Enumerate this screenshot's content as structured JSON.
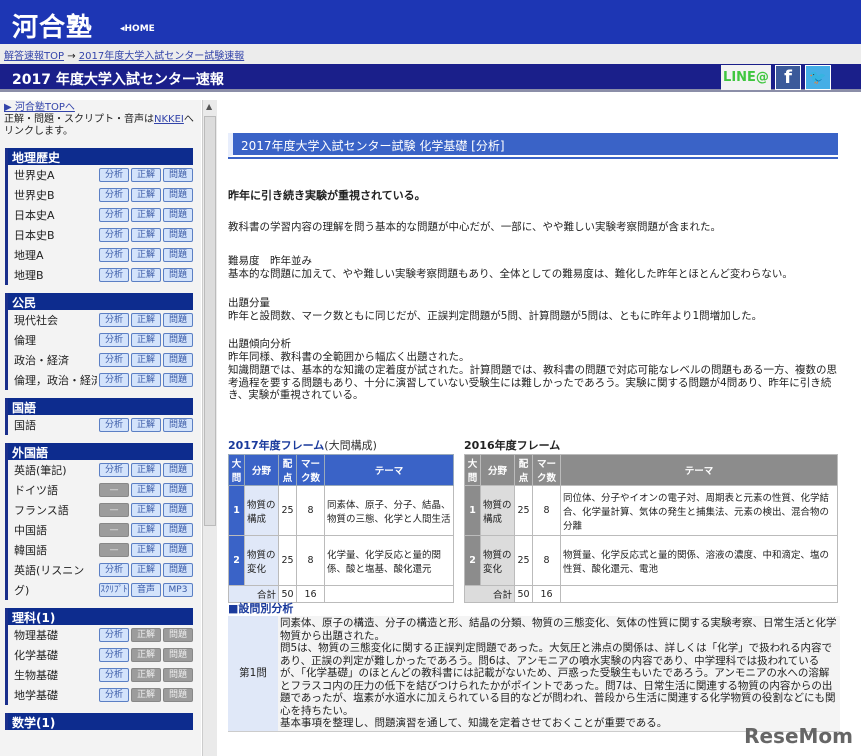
{
  "header": {
    "logo": "河合塾",
    "home": "◂HOME"
  },
  "breadcrumb": {
    "top": "解答速報TOP",
    "arrow": " → ",
    "current": "2017年度大学入試センター試験速報"
  },
  "title_bar": {
    "title": "2017 年度大学入試センター速報",
    "line": "LINE@",
    "facebook": "f",
    "twitter": "t"
  },
  "sidebar": {
    "top_link": "▶ 河合塾TOPへ",
    "note_pre": "正解・問題・スクリプト・音声は",
    "note_link": "NKKEI",
    "note_post": "へリンクします。",
    "sections": [
      {
        "title": "地理歴史",
        "rows": [
          {
            "label": "世界史A",
            "b": [
              "分析",
              "正解",
              "問題"
            ],
            "off": []
          },
          {
            "label": "世界史B",
            "b": [
              "分析",
              "正解",
              "問題"
            ],
            "off": []
          },
          {
            "label": "日本史A",
            "b": [
              "分析",
              "正解",
              "問題"
            ],
            "off": []
          },
          {
            "label": "日本史B",
            "b": [
              "分析",
              "正解",
              "問題"
            ],
            "off": []
          },
          {
            "label": "地理A",
            "b": [
              "分析",
              "正解",
              "問題"
            ],
            "off": []
          },
          {
            "label": "地理B",
            "b": [
              "分析",
              "正解",
              "問題"
            ],
            "off": []
          }
        ]
      },
      {
        "title": "公民",
        "rows": [
          {
            "label": "現代社会",
            "b": [
              "分析",
              "正解",
              "問題"
            ],
            "off": []
          },
          {
            "label": "倫理",
            "b": [
              "分析",
              "正解",
              "問題"
            ],
            "off": []
          },
          {
            "label": "政治・経済",
            "b": [
              "分析",
              "正解",
              "問題"
            ],
            "off": []
          },
          {
            "label": "倫理，政治・経済",
            "b": [
              "分析",
              "正解",
              "問題"
            ],
            "off": []
          }
        ]
      },
      {
        "title": "国語",
        "rows": [
          {
            "label": "国語",
            "b": [
              "分析",
              "正解",
              "問題"
            ],
            "off": []
          }
        ]
      },
      {
        "title": "外国語",
        "rows": [
          {
            "label": "英語(筆記)",
            "b": [
              "分析",
              "正解",
              "問題"
            ],
            "off": []
          },
          {
            "label": "ドイツ語",
            "b": [
              "—",
              "正解",
              "問題"
            ],
            "off": [
              0
            ]
          },
          {
            "label": "フランス語",
            "b": [
              "—",
              "正解",
              "問題"
            ],
            "off": [
              0
            ]
          },
          {
            "label": "中国語",
            "b": [
              "—",
              "正解",
              "問題"
            ],
            "off": [
              0
            ]
          },
          {
            "label": "韓国語",
            "b": [
              "—",
              "正解",
              "問題"
            ],
            "off": [
              0
            ]
          },
          {
            "label": "英語(リスニン",
            "b": [
              "分析",
              "正解",
              "問題"
            ],
            "off": []
          },
          {
            "label": "グ)",
            "b": [
              "ｽｸﾘﾌﾟﾄ",
              "音声",
              "MP3"
            ],
            "off": []
          }
        ]
      },
      {
        "title": "理科(1)",
        "rows": [
          {
            "label": "物理基礎",
            "b": [
              "分析",
              "正解",
              "問題"
            ],
            "off": [
              1,
              2
            ]
          },
          {
            "label": "化学基礎",
            "b": [
              "分析",
              "正解",
              "問題"
            ],
            "off": [
              1,
              2
            ]
          },
          {
            "label": "生物基礎",
            "b": [
              "分析",
              "正解",
              "問題"
            ],
            "off": [
              1,
              2
            ]
          },
          {
            "label": "地学基礎",
            "b": [
              "分析",
              "正解",
              "問題"
            ],
            "off": [
              1,
              2
            ]
          }
        ]
      },
      {
        "title": "数学(1)",
        "rows": []
      }
    ]
  },
  "main": {
    "page_title": "2017年度大学入試センター試験 化学基礎 [分析]",
    "lead": "昨年に引き続き実験が重視されている。",
    "intro": "教科書の学習内容の理解を問う基本的な問題が中心だが、一部に、やや難しい実験考察問題が含まれた。",
    "difficulty_h": "難易度　昨年並み",
    "difficulty": "基本的な問題に加えて、やや難しい実験考察問題もあり、全体としての難易度は、難化した昨年とほとんど変わらない。",
    "volume_h": "出題分量",
    "volume": "昨年と設問数、マーク数ともに同じだが、正誤判定問題が5問、計算問題が5問は、ともに昨年より1問増加した。",
    "trend_h": "出題傾向分析",
    "trend1": "昨年同様、教科書の全範囲から幅広く出題された。",
    "trend2": "知識問題では、基本的な知識の定着度が試された。計算問題では、教科書の問題で対応可能なレベルの問題もある一方、複数の思考過程を要する問題もあり、十分に演習していない受験生には難しかったであろう。実験に関する問題が4問あり、昨年に引き続き、実験が重視されている。"
  },
  "headers": [
    "大問",
    "分野",
    "配点",
    "マーク数",
    "テーマ"
  ],
  "table2017": {
    "caption": "2017年度フレーム",
    "caption_sub": "(大問構成)",
    "rows": [
      [
        "1",
        "物質の構成",
        "25",
        "8",
        "同素体、原子、分子、結晶、物質の三態、化学と人間生活"
      ],
      [
        "2",
        "物質の変化",
        "25",
        "8",
        "化学量、化学反応と量的関係、酸と塩基、酸化還元"
      ]
    ],
    "total": [
      "合計",
      "50",
      "16"
    ]
  },
  "table2016": {
    "caption": "2016年度フレーム",
    "rows": [
      [
        "1",
        "物質の構成",
        "25",
        "8",
        "同位体、分子やイオンの電子対、周期表と元素の性質、化学結合、化学量計算、気体の発生と捕集法、元素の検出、混合物の分離"
      ],
      [
        "2",
        "物質の変化",
        "25",
        "8",
        "物質量、化学反応式と量的関係、溶液の濃度、中和滴定、塩の性質、酸化還元、電池"
      ]
    ],
    "total": [
      "合計",
      "50",
      "16"
    ]
  },
  "question_analysis": {
    "title": "■設問別分析",
    "q": "第1問",
    "body": [
      "同素体、原子の構造、分子の構造と形、結晶の分類、物質の三態変化、気体の性質に関する実験考察、日常生活と化学物質から出題された。",
      "問5は、物質の三態変化に関する正誤判定問題であった。大気圧と沸点の関係は、詳しくは「化学」で扱われる内容であり、正誤の判定が難しかったであろう。問6は、アンモニアの噴水実験の内容であり、中学理科では扱われているが、「化学基礎」のほとんどの教科書には記載がないため、戸惑った受験生もいたであろう。アンモニアの水への溶解とフラスコ内の圧力の低下を結びつけられたかがポイントであった。問7は、日常生活に関連する物質の内容からの出題であったが、塩素が水道水に加えられている目的などが問われ、普段から生活に関連する化学物質の役割などにも関心を持ちたい。",
      "基本事項を整理し、問題演習を通して、知識を定着させておくことが重要である。"
    ]
  },
  "watermark": "ReseMom"
}
